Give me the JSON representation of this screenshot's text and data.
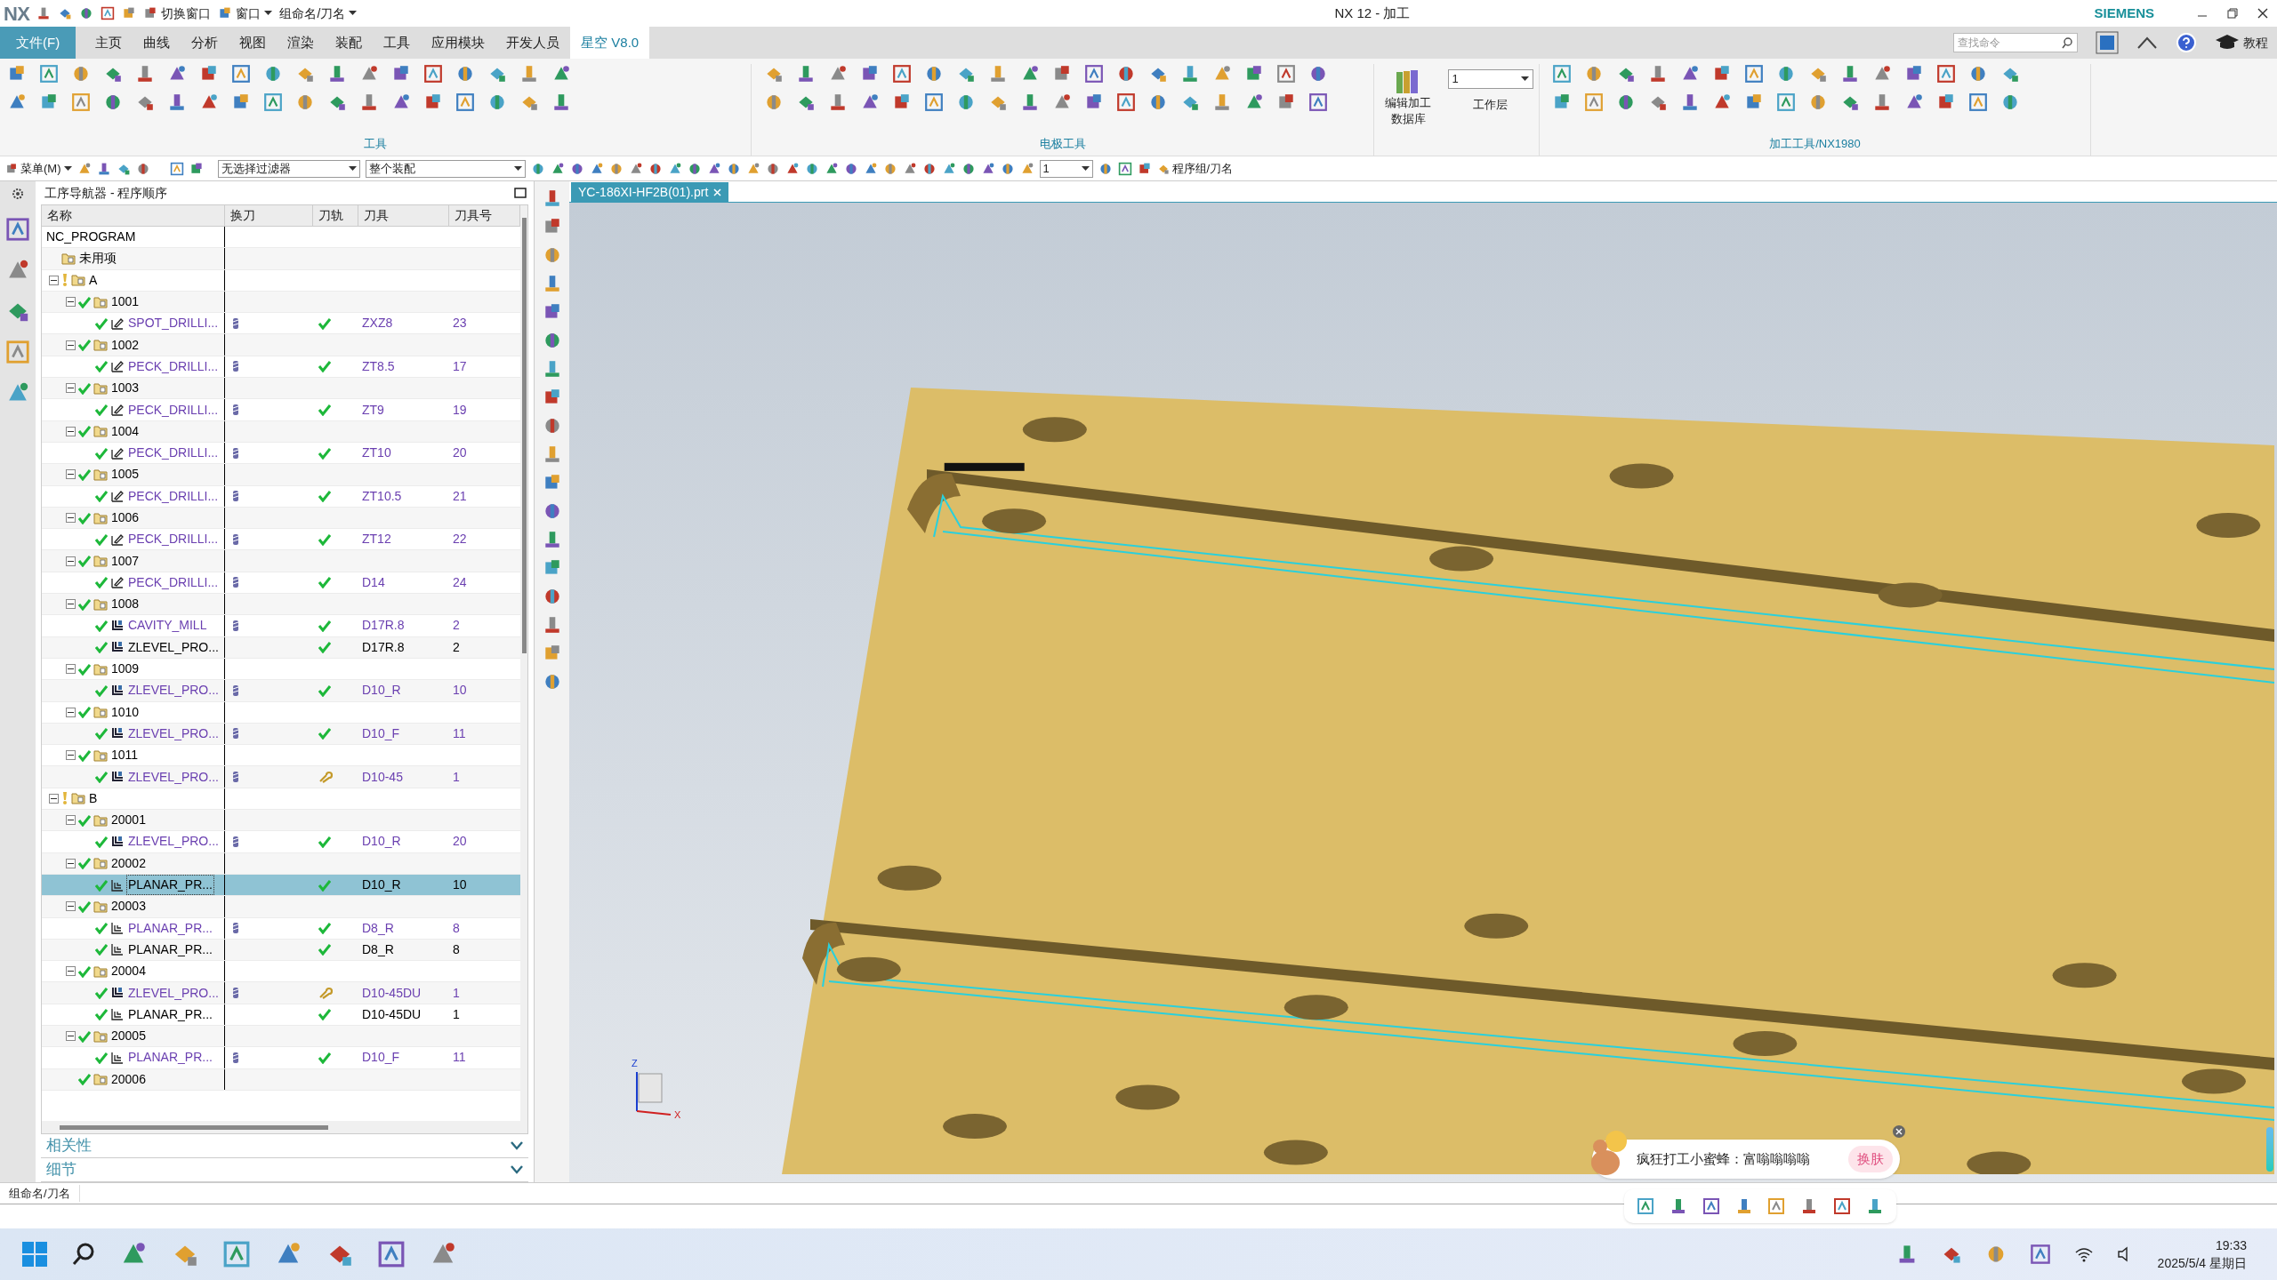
{
  "title_bar": {
    "logo": "NX",
    "quick_actions": [
      "切换窗口",
      "窗口",
      "组命名/刀名"
    ],
    "title": "NX 12 - 加工",
    "brand": "SIEMENS"
  },
  "menu_tabs": [
    {
      "label": "文件(F)",
      "kind": "file",
      "selected": false
    },
    {
      "label": "主页",
      "kind": "tab",
      "selected": false
    },
    {
      "label": "曲线",
      "kind": "tab",
      "selected": false
    },
    {
      "label": "分析",
      "kind": "tab",
      "selected": false
    },
    {
      "label": "视图",
      "kind": "tab",
      "selected": false
    },
    {
      "label": "渲染",
      "kind": "tab",
      "selected": false
    },
    {
      "label": "装配",
      "kind": "tab",
      "selected": false
    },
    {
      "label": "工具",
      "kind": "tab",
      "selected": false
    },
    {
      "label": "应用模块",
      "kind": "tab",
      "selected": false
    },
    {
      "label": "开发人员",
      "kind": "tab",
      "selected": false
    },
    {
      "label": "星空 V8.0",
      "kind": "tab",
      "selected": true
    }
  ],
  "search": {
    "placeholder": "查找命令"
  },
  "help_label": "教程",
  "ribbon": {
    "groups": [
      "工具",
      "电极工具"
    ],
    "database_button": [
      "编辑加工",
      "数据库"
    ],
    "layer": {
      "value": "1",
      "label": "工作层"
    },
    "machining_group": "加工工具/NX1980"
  },
  "toolbar": {
    "menu": "菜单(M)",
    "filter": "无选择过滤器",
    "scope": "整个装配",
    "number": "1",
    "group_label": "程序组/刀名"
  },
  "navigator": {
    "title": "工序导航器 - 程序顺序",
    "columns": [
      "名称",
      "换刀",
      "刀轨",
      "刀具",
      "刀具号"
    ],
    "tree": [
      {
        "name": "NC_PROGRAM",
        "kind": "root",
        "children": [
          {
            "name": "未用项",
            "kind": "folder"
          },
          {
            "name": "A",
            "kind": "program",
            "warning": true,
            "children": [
              {
                "name": "1001",
                "kind": "group",
                "checked": true,
                "children": [
                  {
                    "name": "SPOT_DRILLI...",
                    "kind": "drill",
                    "checked": true,
                    "tool_change": true,
                    "toolpath_ok": true,
                    "tool": "ZXZ8",
                    "tool_number": "23",
                    "color": "#6a3fb0",
                    "selected": false
                  }
                ]
              },
              {
                "name": "1002",
                "kind": "group",
                "checked": true,
                "children": [
                  {
                    "name": "PECK_DRILLI...",
                    "kind": "drill",
                    "checked": true,
                    "tool_change": true,
                    "toolpath_ok": true,
                    "tool": "ZT8.5",
                    "tool_number": "17",
                    "color": "#6a3fb0",
                    "selected": false
                  }
                ]
              },
              {
                "name": "1003",
                "kind": "group",
                "checked": true,
                "children": [
                  {
                    "name": "PECK_DRILLI...",
                    "kind": "drill",
                    "checked": true,
                    "tool_change": true,
                    "toolpath_ok": true,
                    "tool": "ZT9",
                    "tool_number": "19",
                    "color": "#6a3fb0",
                    "selected": false
                  }
                ]
              },
              {
                "name": "1004",
                "kind": "group",
                "checked": true,
                "children": [
                  {
                    "name": "PECK_DRILLI...",
                    "kind": "drill",
                    "checked": true,
                    "tool_change": true,
                    "toolpath_ok": true,
                    "tool": "ZT10",
                    "tool_number": "20",
                    "color": "#6a3fb0",
                    "selected": false
                  }
                ]
              },
              {
                "name": "1005",
                "kind": "group",
                "checked": true,
                "children": [
                  {
                    "name": "PECK_DRILLI...",
                    "kind": "drill",
                    "checked": true,
                    "tool_change": true,
                    "toolpath_ok": true,
                    "tool": "ZT10.5",
                    "tool_number": "21",
                    "color": "#6a3fb0",
                    "selected": false
                  }
                ]
              },
              {
                "name": "1006",
                "kind": "group",
                "checked": true,
                "children": [
                  {
                    "name": "PECK_DRILLI...",
                    "kind": "drill",
                    "checked": true,
                    "tool_change": true,
                    "toolpath_ok": true,
                    "tool": "ZT12",
                    "tool_number": "22",
                    "color": "#6a3fb0",
                    "selected": false
                  }
                ]
              },
              {
                "name": "1007",
                "kind": "group",
                "checked": true,
                "children": [
                  {
                    "name": "PECK_DRILLI...",
                    "kind": "drill",
                    "checked": true,
                    "tool_change": true,
                    "toolpath_ok": true,
                    "tool": "D14",
                    "tool_number": "24",
                    "color": "#6a3fb0",
                    "selected": false
                  }
                ]
              },
              {
                "name": "1008",
                "kind": "group",
                "checked": true,
                "children": [
                  {
                    "name": "CAVITY_MILL",
                    "kind": "mill",
                    "checked": true,
                    "tool_change": true,
                    "toolpath_ok": true,
                    "tool": "D17R.8",
                    "tool_number": "2",
                    "color": "#6a3fb0",
                    "selected": false
                  },
                  {
                    "name": "ZLEVEL_PRO...",
                    "kind": "mill",
                    "checked": true,
                    "tool_change": false,
                    "toolpath_ok": true,
                    "tool": "D17R.8",
                    "tool_number": "2",
                    "color": "#000000",
                    "selected": false
                  }
                ]
              },
              {
                "name": "1009",
                "kind": "group",
                "checked": true,
                "children": [
                  {
                    "name": "ZLEVEL_PRO...",
                    "kind": "mill",
                    "checked": true,
                    "tool_change": true,
                    "toolpath_ok": true,
                    "tool": "D10_R",
                    "tool_number": "10",
                    "color": "#6a3fb0",
                    "selected": false
                  }
                ]
              },
              {
                "name": "1010",
                "kind": "group",
                "checked": true,
                "children": [
                  {
                    "name": "ZLEVEL_PRO...",
                    "kind": "mill",
                    "checked": true,
                    "tool_change": true,
                    "toolpath_ok": true,
                    "tool": "D10_F",
                    "tool_number": "11",
                    "color": "#6a3fb0",
                    "selected": false
                  }
                ]
              },
              {
                "name": "1011",
                "kind": "group",
                "checked": true,
                "children": [
                  {
                    "name": "ZLEVEL_PRO...",
                    "kind": "mill",
                    "checked": true,
                    "tool_change": true,
                    "toolpath_ok": false,
                    "tool": "D10-45",
                    "tool_number": "1",
                    "color": "#6a3fb0",
                    "selected": false
                  }
                ]
              }
            ]
          },
          {
            "name": "B",
            "kind": "program",
            "warning": true,
            "children": [
              {
                "name": "20001",
                "kind": "group",
                "checked": true,
                "children": [
                  {
                    "name": "ZLEVEL_PRO...",
                    "kind": "mill",
                    "checked": true,
                    "tool_change": true,
                    "toolpath_ok": true,
                    "tool": "D10_R",
                    "tool_number": "20",
                    "color": "#6a3fb0",
                    "selected": false
                  }
                ]
              },
              {
                "name": "20002",
                "kind": "group",
                "checked": true,
                "children": [
                  {
                    "name": "PLANAR_PR...",
                    "kind": "planar",
                    "checked": true,
                    "tool_change": false,
                    "toolpath_ok": true,
                    "tool": "D10_R",
                    "tool_number": "10",
                    "selected": true
                  }
                ]
              },
              {
                "name": "20003",
                "kind": "group",
                "checked": true,
                "children": [
                  {
                    "name": "PLANAR_PR...",
                    "kind": "planar",
                    "checked": true,
                    "tool_change": true,
                    "toolpath_ok": true,
                    "tool": "D8_R",
                    "tool_number": "8",
                    "color": "#6a3fb0",
                    "selected": false
                  },
                  {
                    "name": "PLANAR_PR...",
                    "kind": "planar",
                    "checked": true,
                    "tool_change": false,
                    "toolpath_ok": true,
                    "tool": "D8_R",
                    "tool_number": "8",
                    "color": "#000000",
                    "selected": false
                  }
                ]
              },
              {
                "name": "20004",
                "kind": "group",
                "checked": true,
                "children": [
                  {
                    "name": "ZLEVEL_PRO...",
                    "kind": "mill",
                    "checked": true,
                    "tool_change": true,
                    "toolpath_ok": false,
                    "tool": "D10-45DU",
                    "tool_number": "1",
                    "color": "#6a3fb0",
                    "selected": false
                  },
                  {
                    "name": "PLANAR_PR...",
                    "kind": "planar",
                    "checked": true,
                    "tool_change": false,
                    "toolpath_ok": true,
                    "tool": "D10-45DU",
                    "tool_number": "1",
                    "color": "#000000",
                    "selected": false
                  }
                ]
              },
              {
                "name": "20005",
                "kind": "group",
                "checked": true,
                "children": [
                  {
                    "name": "PLANAR_PR...",
                    "kind": "planar",
                    "checked": true,
                    "tool_change": true,
                    "toolpath_ok": true,
                    "tool": "D10_F",
                    "tool_number": "11",
                    "color": "#6a3fb0",
                    "selected": false
                  }
                ]
              },
              {
                "name": "20006",
                "kind": "group",
                "checked": true
              }
            ]
          }
        ]
      }
    ],
    "sections": [
      "相关性",
      "细节"
    ]
  },
  "viewport": {
    "tab": "YC-186XI-HF2B(01).prt",
    "axis_labels": [
      "Z",
      "X"
    ]
  },
  "popup": {
    "text": "疯狂打工小蜜蜂：富嗡嗡嗡嗡",
    "button": "换肤"
  },
  "status_bar": "组命名/刀名",
  "taskbar": {
    "time": "19:33",
    "date": "2025/5/4 星期日"
  }
}
